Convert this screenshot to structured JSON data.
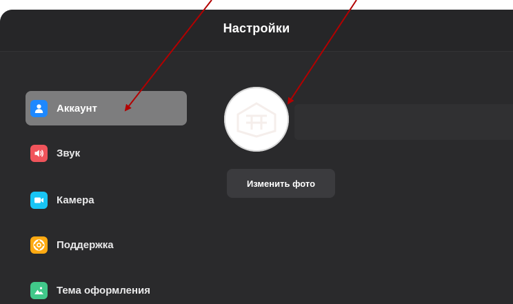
{
  "window": {
    "title": "Настройки"
  },
  "sidebar": {
    "items": [
      {
        "label": "Аккаунт",
        "icon": "user-icon",
        "color": "#1e88ff",
        "active": true
      },
      {
        "label": "Звук",
        "icon": "speaker-icon",
        "color": "#f0545b",
        "active": false
      },
      {
        "label": "Камера",
        "icon": "camera-icon",
        "color": "#18c5f5",
        "active": false
      },
      {
        "label": "Поддержка",
        "icon": "lifebuoy-icon",
        "color": "#ffaa12",
        "active": false
      },
      {
        "label": "Тема оформления",
        "icon": "image-icon",
        "color": "#41c88a",
        "active": false
      }
    ]
  },
  "account": {
    "change_photo_label": "Изменить фото",
    "name_value": ""
  },
  "annotations": {
    "arrow_color": "#b30000"
  }
}
